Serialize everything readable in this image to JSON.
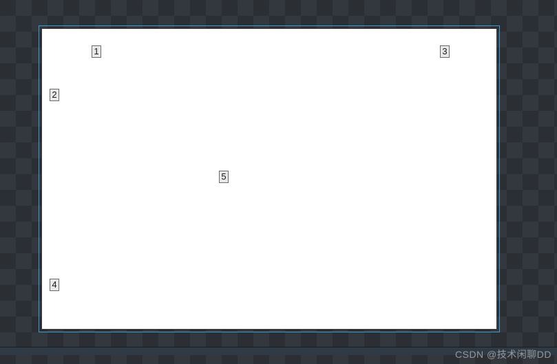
{
  "canvas": {
    "selected": true,
    "background": "#ffffff",
    "selection_border": "#3b9ed8"
  },
  "anchors": [
    {
      "id": 1,
      "label": "1"
    },
    {
      "id": 2,
      "label": "2"
    },
    {
      "id": 3,
      "label": "3"
    },
    {
      "id": 4,
      "label": "4"
    },
    {
      "id": 5,
      "label": "5"
    }
  ],
  "watermark": "CSDN @技术闲聊DD"
}
